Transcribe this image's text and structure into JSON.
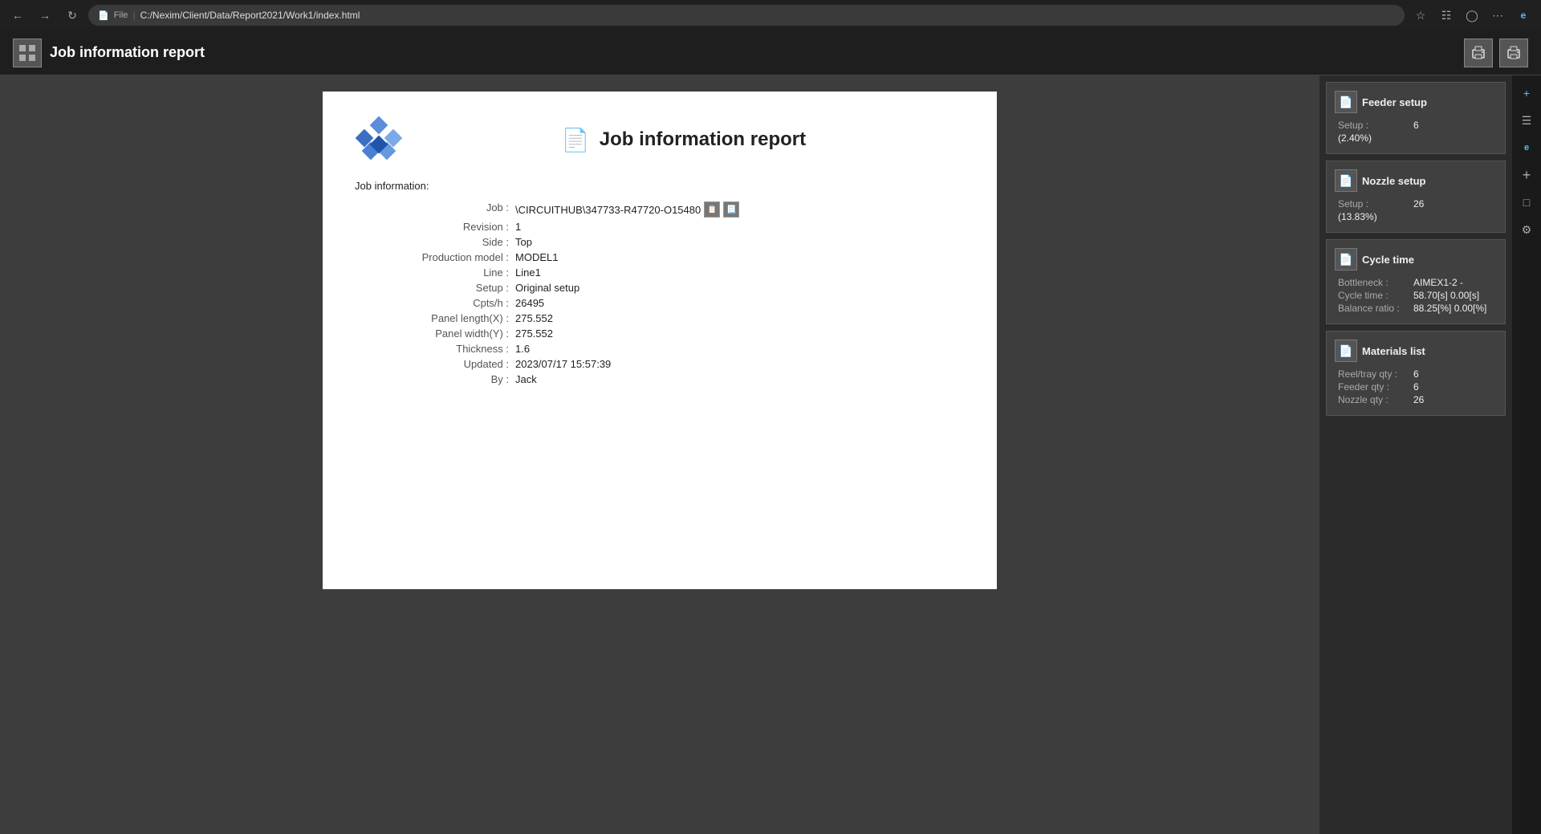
{
  "browser": {
    "address": "C:/Nexim/Client/Data/Report2021/Work1/index.html",
    "file_label": "File"
  },
  "app_header": {
    "title": "Job information report",
    "print_btn1_label": "🖨",
    "print_btn2_label": "🖨"
  },
  "paper": {
    "title": "Job information report",
    "section_label": "Job information:",
    "fields": [
      {
        "label": "Job :",
        "value": "\\CIRCUITHUB\\347733-R47720-O15480",
        "has_icons": true
      },
      {
        "label": "Revision :",
        "value": "1"
      },
      {
        "label": "Side :",
        "value": "Top"
      },
      {
        "label": "Production model :",
        "value": "MODEL1"
      },
      {
        "label": "Line :",
        "value": "Line1"
      },
      {
        "label": "Setup :",
        "value": "Original setup"
      },
      {
        "label": "Cpts/h :",
        "value": "26495"
      },
      {
        "label": "Panel length(X) :",
        "value": "275.552"
      },
      {
        "label": "Panel width(Y) :",
        "value": "275.552"
      },
      {
        "label": "Thickness :",
        "value": "1.6"
      },
      {
        "label": "Updated :",
        "value": "2023/07/17 15:57:39"
      },
      {
        "label": "By :",
        "value": "Jack"
      }
    ]
  },
  "sidebar": {
    "cards": [
      {
        "id": "feeder-setup",
        "title": "Feeder setup",
        "rows": [
          {
            "label": "Setup :",
            "value": "6"
          },
          {
            "label": "",
            "value": "(2.40%)"
          }
        ]
      },
      {
        "id": "nozzle-setup",
        "title": "Nozzle setup",
        "rows": [
          {
            "label": "Setup :",
            "value": "26"
          },
          {
            "label": "",
            "value": "(13.83%)"
          }
        ]
      },
      {
        "id": "cycle-time",
        "title": "Cycle time",
        "rows": [
          {
            "label": "Bottleneck :",
            "value": "AIMEX1-2   -"
          },
          {
            "label": "Cycle time :",
            "value": "58.70[s]   0.00[s]"
          },
          {
            "label": "Balance ratio :",
            "value": "88.25[%]   0.00[%]"
          }
        ]
      },
      {
        "id": "materials-list",
        "title": "Materials list",
        "rows": [
          {
            "label": "Reel/tray qty :",
            "value": "6"
          },
          {
            "label": "Feeder qty :",
            "value": "6"
          },
          {
            "label": "Nozzle qty :",
            "value": "26"
          }
        ]
      }
    ]
  }
}
